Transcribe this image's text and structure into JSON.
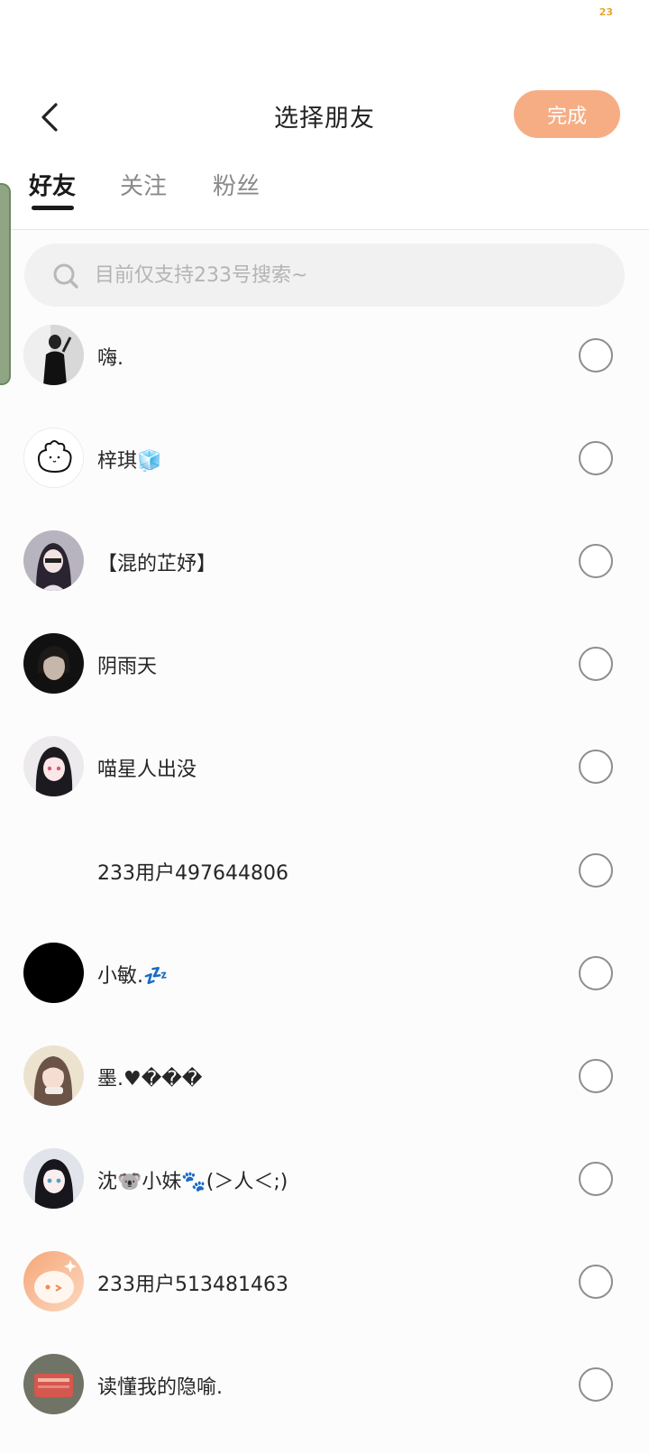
{
  "status_bar": {
    "badge": "23"
  },
  "header": {
    "title": "选择朋友",
    "done_label": "完成"
  },
  "tabs": [
    {
      "label": "好友",
      "active": true
    },
    {
      "label": "关注",
      "active": false
    },
    {
      "label": "粉丝",
      "active": false
    }
  ],
  "search": {
    "placeholder": "目前仅支持233号搜索~",
    "value": ""
  },
  "friends": [
    {
      "name": "嗨."
    },
    {
      "name": "梓琪🧊"
    },
    {
      "name": "【混的芷妤】"
    },
    {
      "name": "阴雨天"
    },
    {
      "name": "喵星人出没"
    },
    {
      "name": "233用户497644806"
    },
    {
      "name": "小敏.💤"
    },
    {
      "name": "墨.♥���"
    },
    {
      "name": "沈🐨小妹🐾(＞人＜;)"
    },
    {
      "name": "233用户513481463"
    },
    {
      "name": "读懂我的隐喻."
    }
  ],
  "colors": {
    "accent": "#f7ad84",
    "badge": "#e7a72d",
    "side_handle": "#8fa583"
  }
}
